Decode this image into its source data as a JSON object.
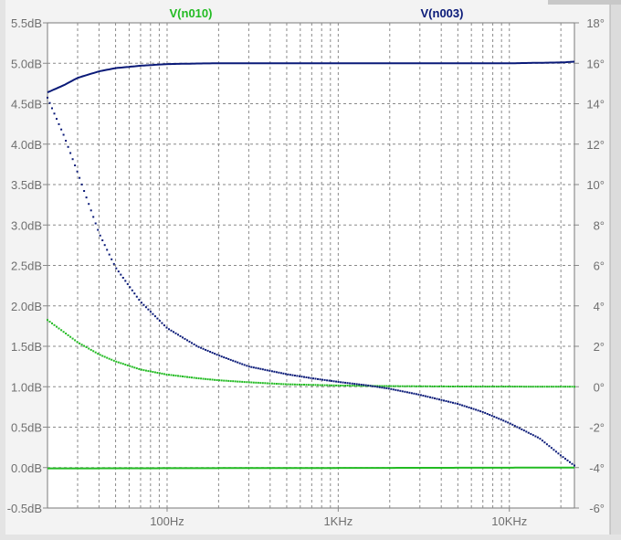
{
  "chart_data": {
    "type": "line",
    "x_scale": "log",
    "xlim": [
      20,
      24000
    ],
    "x_ticks": [
      100,
      1000,
      10000
    ],
    "x_tick_labels": [
      "100Hz",
      "1KHz",
      "10KHz"
    ],
    "y_left": {
      "unit": "dB",
      "ylim": [
        -0.5,
        5.5
      ],
      "ticks": [
        5.5,
        5.0,
        4.5,
        4.0,
        3.5,
        3.0,
        2.5,
        2.0,
        1.5,
        1.0,
        0.5,
        0.0,
        -0.5
      ],
      "tick_labels": [
        "5.5dB",
        "5.0dB",
        "4.5dB",
        "4.0dB",
        "3.5dB",
        "3.0dB",
        "2.5dB",
        "2.0dB",
        "1.5dB",
        "1.0dB",
        "0.5dB",
        "0.0dB",
        "-0.5dB"
      ]
    },
    "y_right": {
      "unit": "°",
      "ylim": [
        -6,
        18
      ],
      "ticks": [
        18,
        16,
        14,
        12,
        10,
        8,
        6,
        4,
        2,
        0,
        -2,
        -4,
        -6
      ],
      "tick_labels": [
        "18°",
        "16°",
        "14°",
        "12°",
        "10°",
        "8°",
        "6°",
        "4°",
        "2°",
        "0°",
        "-2°",
        "-4°",
        "-6°"
      ]
    },
    "grid": true,
    "series": [
      {
        "name": "V(n010)",
        "color": "#22bb22",
        "magnitude_db": {
          "x": [
            20,
            24000
          ],
          "y": [
            -0.01,
            0.0
          ]
        },
        "phase_deg": {
          "x": [
            20,
            30,
            40,
            50,
            70,
            100,
            150,
            200,
            300,
            500,
            1000,
            2000,
            5000,
            24000
          ],
          "y": [
            3.3,
            2.2,
            1.6,
            1.25,
            0.85,
            0.6,
            0.42,
            0.32,
            0.22,
            0.12,
            0.06,
            0.03,
            0.01,
            0.0
          ]
        }
      },
      {
        "name": "V(n003)",
        "color": "#0a1a78",
        "magnitude_db": {
          "x": [
            20,
            25,
            30,
            40,
            50,
            70,
            100,
            150,
            200,
            500,
            1000,
            5000,
            10000,
            20000,
            24000
          ],
          "y": [
            4.64,
            4.73,
            4.82,
            4.9,
            4.94,
            4.97,
            4.99,
            4.997,
            5.0,
            5.0,
            5.0,
            5.0,
            5.0,
            5.01,
            5.02
          ]
        },
        "phase_deg": {
          "x": [
            20,
            25,
            30,
            40,
            50,
            70,
            100,
            150,
            200,
            300,
            500,
            700,
            1000,
            1500,
            2000,
            3000,
            5000,
            7000,
            10000,
            15000,
            20000,
            24000
          ],
          "y": [
            14.3,
            12.4,
            10.6,
            7.6,
            5.9,
            4.2,
            2.9,
            2.0,
            1.55,
            1.0,
            0.62,
            0.42,
            0.24,
            0.06,
            -0.1,
            -0.4,
            -0.85,
            -1.25,
            -1.8,
            -2.55,
            -3.4,
            -3.9
          ]
        }
      }
    ]
  }
}
